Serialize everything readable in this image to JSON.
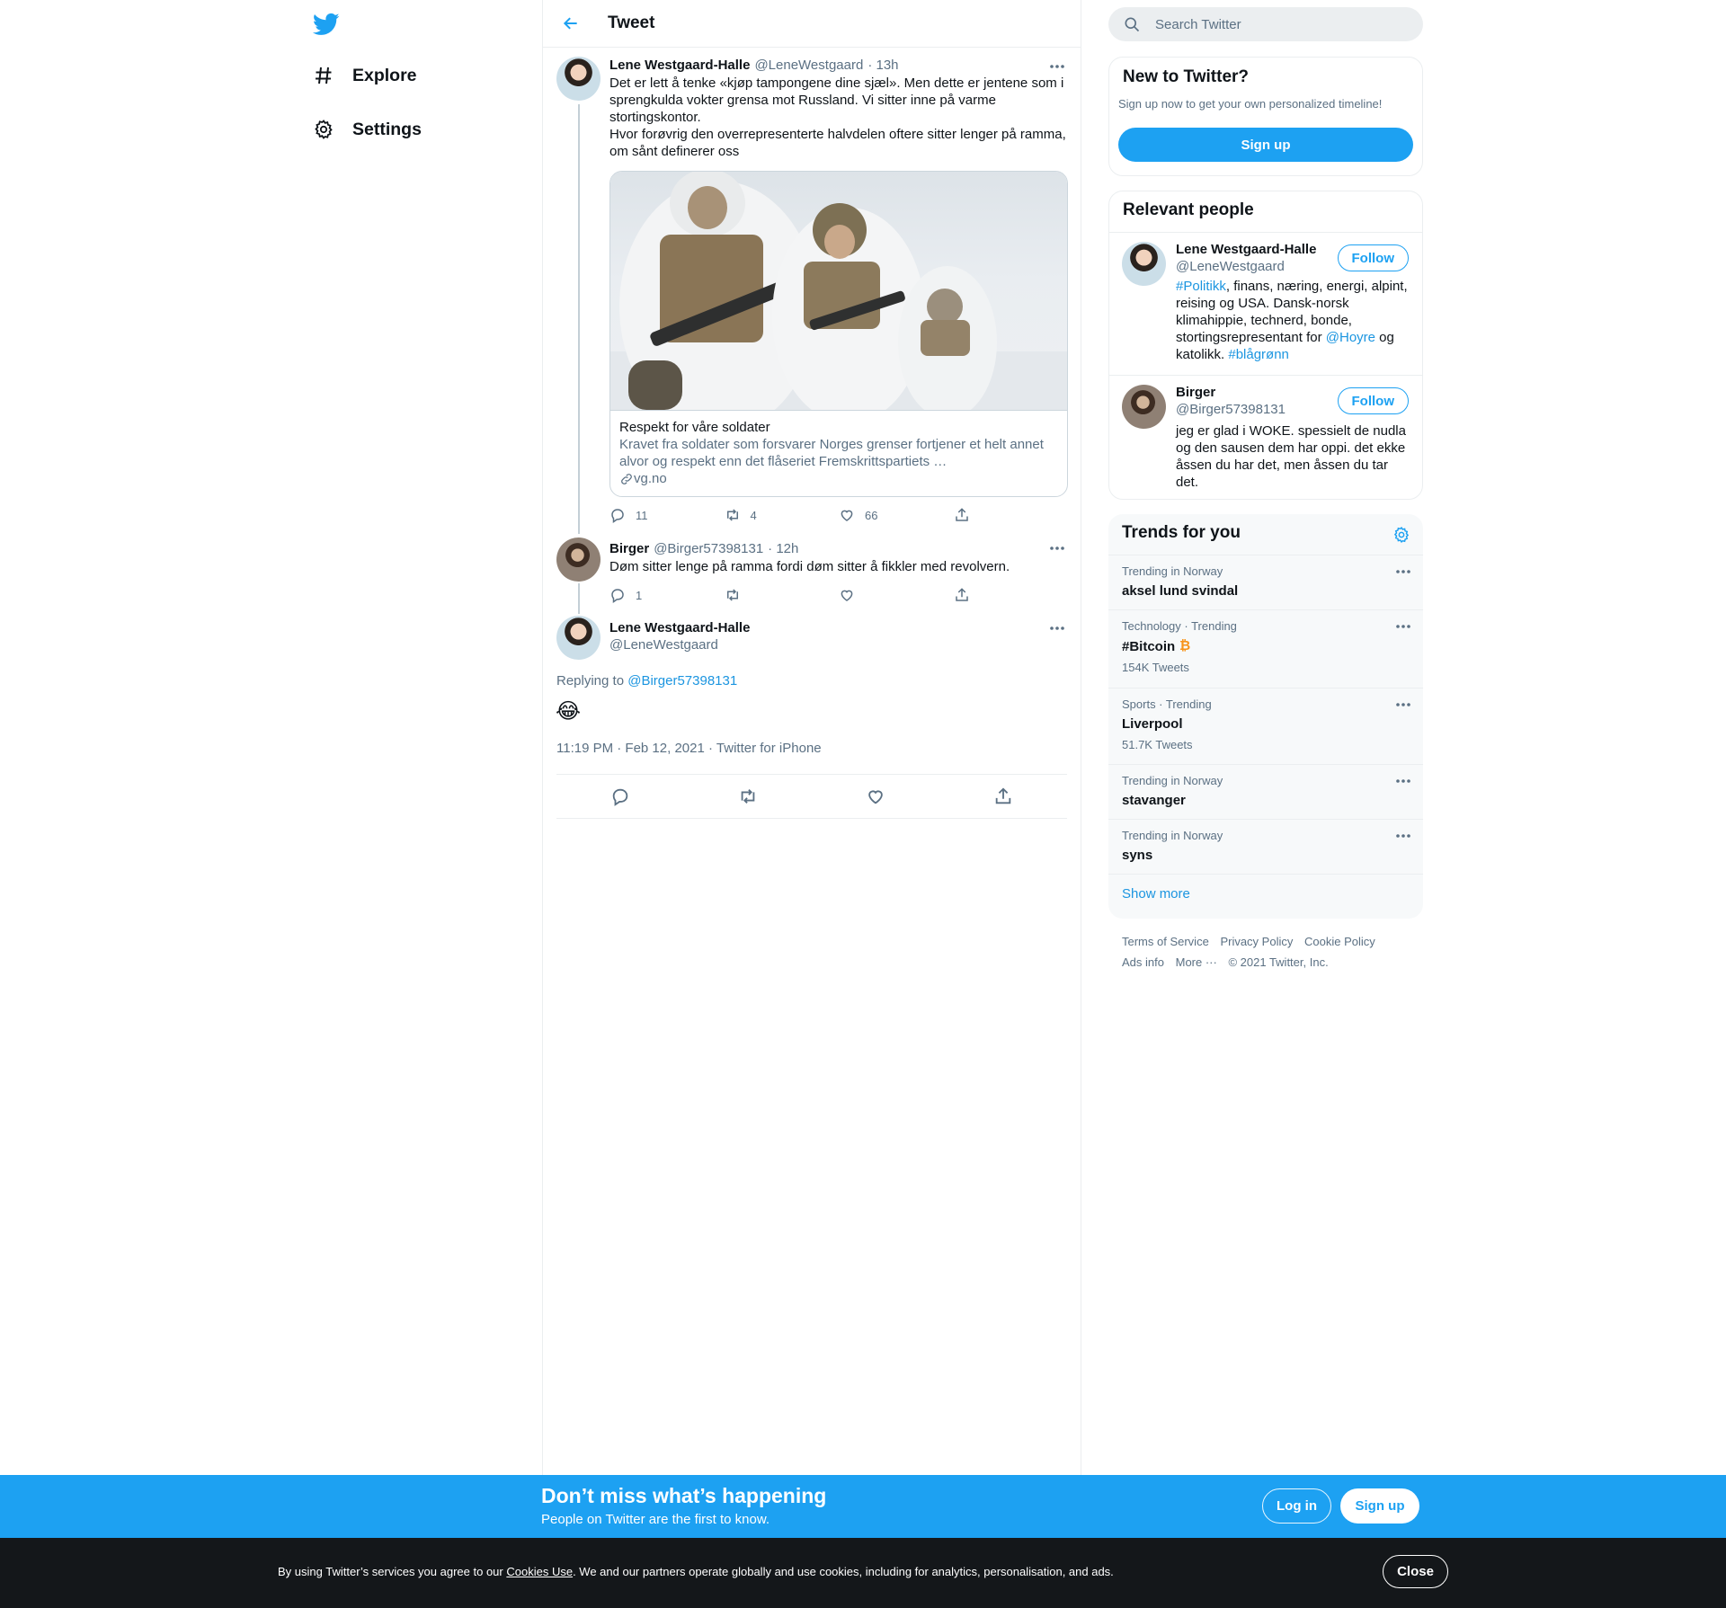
{
  "nav": {
    "items": [
      {
        "label": "Explore",
        "icon": "hashtag-icon"
      },
      {
        "label": "Settings",
        "icon": "gear-icon"
      }
    ]
  },
  "main": {
    "header_title": "Tweet",
    "tweets": [
      {
        "name": "Lene Westgaard-Halle",
        "handle": "@LeneWestgaard",
        "time": "· 13h",
        "text_lines": [
          "Det er lett å tenke «kjøp tampongene dine sjæl». Men dette er jentene som i",
          "sprengkulda vokter grensa mot Russland. Vi sitter inne på varme",
          "stortingskontor.",
          "Hvor forøvrig den overrepresenterte halvdelen oftere sitter lenger på ramma,",
          "om sånt definerer oss"
        ],
        "card": {
          "title": "Respekt for våre soldater",
          "desc_lines": [
            "Kravet fra soldater som forsvarer Norges grenser fortjener et helt annet",
            "alvor og respekt enn det flåseriet Fremskrittspartiets …"
          ],
          "domain": "vg.no"
        },
        "replies": "11",
        "retweets": "4",
        "likes": "66"
      },
      {
        "name": "Birger",
        "handle": "@Birger57398131",
        "time": "· 12h",
        "text": "Døm sitter lenge på ramma fordi døm sitter å fikkler med revolvern.",
        "replies": "1"
      }
    ],
    "focused": {
      "name": "Lene Westgaard-Halle",
      "handle": "@LeneWestgaard",
      "replying_prefix": "Replying to",
      "replying_to": "@Birger57398131",
      "emoji": "😂",
      "date": "11:19 PM · Feb 12, 2021",
      "source": "Twitter for iPhone"
    }
  },
  "right": {
    "search_placeholder": "Search Twitter",
    "new_to_twitter": {
      "title": "New to Twitter?",
      "subtitle": "Sign up now to get your own personalized timeline!",
      "button": "Sign up"
    },
    "relevant": {
      "title": "Relevant people",
      "people": [
        {
          "name": "Lene Westgaard-Halle",
          "handle": "@LeneWestgaard",
          "follow": "Follow",
          "bio_parts": [
            "#Politikk",
            ", finans, næring, energi, alpint,",
            "reising og USA. Dansk-norsk",
            "klimahippie, technerd, bonde,",
            "stortingsrepresentant for ",
            "@Hoyre",
            " og",
            "katolikk. ",
            "#blågrønn"
          ]
        },
        {
          "name": "Birger",
          "handle": "@Birger57398131",
          "follow": "Follow",
          "bio_lines": [
            "jeg er glad i WOKE. spessielt de nudla",
            "og den sausen dem har oppi. det ekke",
            "åssen du har det, men åssen du tar",
            "det."
          ]
        }
      ]
    },
    "trends": {
      "title": "Trends for you",
      "items": [
        {
          "meta": "Trending in Norway",
          "name": "aksel lund svindal",
          "count": ""
        },
        {
          "meta": "Technology · Trending",
          "name": "#Bitcoin",
          "count": "154K Tweets"
        },
        {
          "meta": "Sports · Trending",
          "name": "Liverpool",
          "count": "51.7K Tweets"
        },
        {
          "meta": "Trending in Norway",
          "name": "stavanger",
          "count": ""
        },
        {
          "meta": "Trending in Norway",
          "name": "syns",
          "count": ""
        }
      ],
      "show_more": "Show more"
    },
    "footer": {
      "row1": [
        "Terms of Service",
        "Privacy Policy",
        "Cookie Policy"
      ],
      "row2": [
        "Ads info",
        "More ···",
        "© 2021 Twitter, Inc."
      ]
    }
  },
  "signup_bar": {
    "headline": "Don’t miss what’s happening",
    "sub": "People on Twitter are the first to know.",
    "login": "Log in",
    "signup": "Sign up"
  },
  "cookie_bar": {
    "text_before": "By using Twitter’s services you agree to our ",
    "link": "Cookies Use",
    "text_after": ". We and our partners operate globally and use cookies, including for analytics, personalisation, and ads.",
    "close": "Close"
  },
  "colors": {
    "accent": "#1da1f2",
    "link": "#1b95e0",
    "muted": "#5b7083",
    "bitcoin": "#f7931a"
  }
}
